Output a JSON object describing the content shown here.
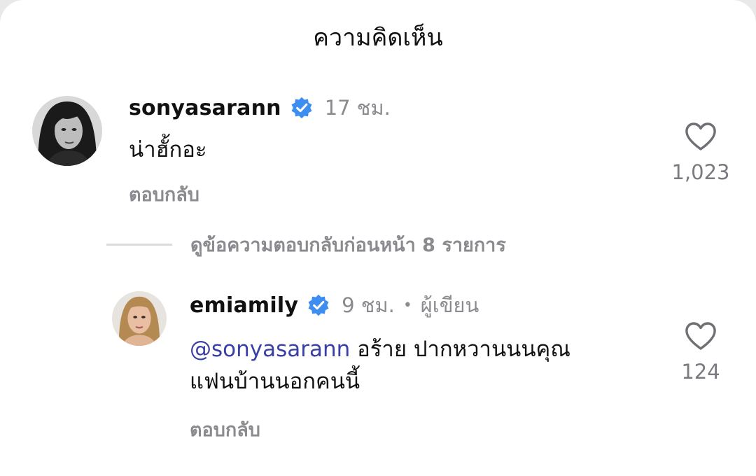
{
  "header": {
    "title": "ความคิดเห็น"
  },
  "comments": [
    {
      "username": "sonyasarann",
      "verified": true,
      "time": "17 ชม.",
      "text": "น่าฮั้กอะ",
      "reply_label": "ตอบกลับ",
      "likes": "1,023",
      "avatar_icon": "woman-portrait-bw"
    }
  ],
  "view_replies": {
    "label": "ดูข้อความตอบกลับก่อนหน้า 8 รายการ"
  },
  "replies": [
    {
      "username": "emiamily",
      "verified": true,
      "time": "9 ชม.",
      "separator": "•",
      "badge": "ผู้เขียน",
      "mention": "@sonyasarann",
      "text_line1": " อร้าย ปากหวานนนคุณ",
      "text_line2": "แฟนบ้านนอกคนนี้",
      "reply_label": "ตอบกลับ",
      "likes": "124",
      "avatar_icon": "woman-portrait-color"
    }
  ],
  "colors": {
    "mention": "#3a3fa6",
    "verified": "#3d8ef0",
    "muted": "#8a8a8f"
  }
}
